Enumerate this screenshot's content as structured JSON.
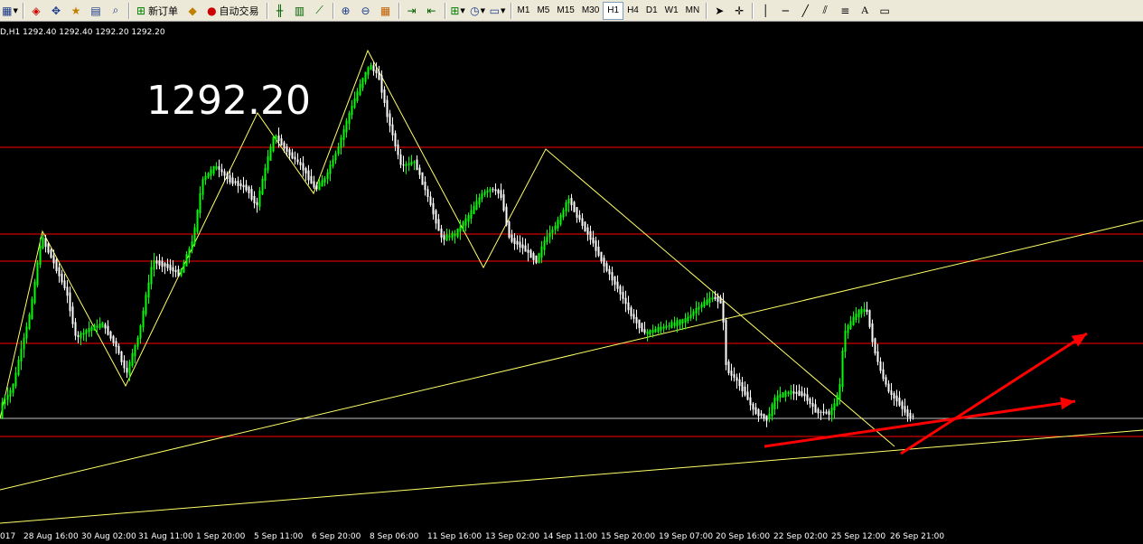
{
  "toolbar": {
    "new_order_label": "新订单",
    "auto_trade_label": "自动交易",
    "timeframes": [
      "M1",
      "M5",
      "M15",
      "M30",
      "H1",
      "H4",
      "D1",
      "W1",
      "MN"
    ],
    "active_timeframe": "H1",
    "text_tool": "A"
  },
  "chart": {
    "symbol_label": "D,H1",
    "ohlc": "1292.40 1292.40 1292.20 1292.20",
    "price_overlay": "1292.20",
    "bull_color": "#00ff00",
    "bear_color": "#ffffff",
    "zigzag_color": "#ffff66",
    "level_color": "#ff0000",
    "arrow_color": "#ff0000",
    "time_labels": [
      "017",
      "28 Aug 16:00",
      "30 Aug 02:00",
      "31 Aug 11:00",
      "1 Sep 20:00",
      "5 Sep 11:00",
      "6 Sep 20:00",
      "8 Sep 06:00",
      "11 Sep 16:00",
      "13 Sep 02:00",
      "14 Sep 11:00",
      "15 Sep 20:00",
      "19 Sep 07:00",
      "20 Sep 16:00",
      "22 Sep 02:00",
      "25 Sep 12:00",
      "26 Sep 21:00"
    ]
  }
}
